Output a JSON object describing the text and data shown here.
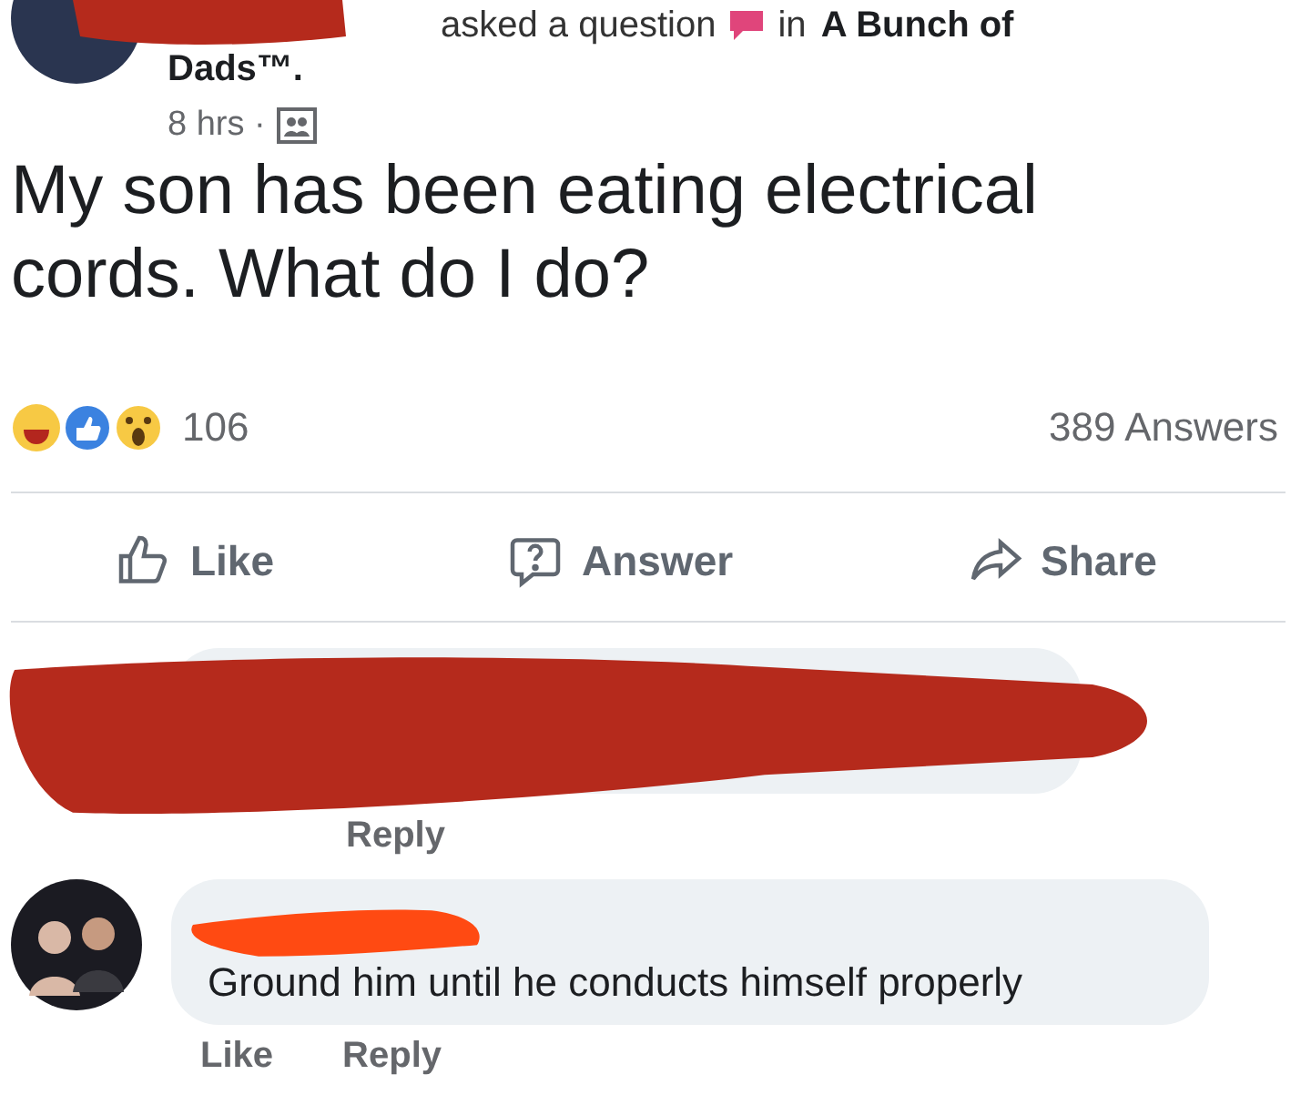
{
  "post": {
    "header": {
      "action": "asked a question",
      "in": "in",
      "group": "A Bunch of",
      "group_end": "Dads™.",
      "time": "8 hrs ·"
    },
    "question": "My son has been eating electrical cords. What do I do?",
    "reactions": {
      "count": "106"
    },
    "answers_count": "389 Answers",
    "actions": [
      {
        "kind": "like",
        "label": "Like"
      },
      {
        "kind": "answer",
        "label": "Answer"
      },
      {
        "kind": "share",
        "label": "Share"
      }
    ]
  },
  "comments": [
    {
      "redacted": true,
      "text_visible": false,
      "actions": [
        "Reply"
      ]
    },
    {
      "redacted": true,
      "text_visible": true,
      "text": "Ground him until he conducts himself properly",
      "actions": [
        "Like",
        "Reply"
      ]
    }
  ]
}
